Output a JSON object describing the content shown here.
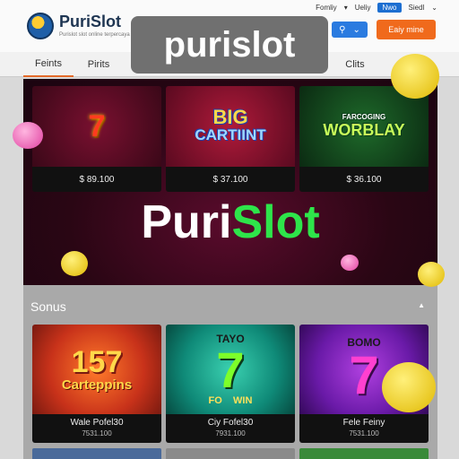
{
  "header": {
    "brand": "PuriSlot",
    "tagline": "Purislot slot online terpercaya",
    "top_links": [
      "Fomliy",
      "Ueliy"
    ],
    "top_badge": "Nwo",
    "top_right": "Siedl",
    "search_icon": "search-icon",
    "cta_label": "Eaiy mine"
  },
  "watermark": "purislot",
  "nav": {
    "tabs": [
      "Feints",
      "Pirits",
      "Clits"
    ]
  },
  "hero": {
    "cards": [
      {
        "art": "7",
        "price": "$ 89.100"
      },
      {
        "art_line1": "BIG",
        "art_line2": "CARTIINT",
        "price": "$ 37.100"
      },
      {
        "art_small": "FARCOGING",
        "art": "WORBLAY",
        "price": "$ 36.100"
      }
    ],
    "title_part1": "Puri",
    "title_part2": "Slot"
  },
  "section": {
    "title": "Sonus",
    "promos": [
      {
        "top": "157",
        "label": "Carteppins",
        "title": "Wale Pofel30",
        "sub": "7531.100"
      },
      {
        "top": "TAYO",
        "big": "7",
        "label": "FO    WIN",
        "title": "Ciy Fofel30",
        "sub": "7931.100"
      },
      {
        "top": "BOMO",
        "big": "7",
        "title": "Fele Feiny",
        "sub": "7531.100"
      }
    ]
  },
  "colors": {
    "accent": "#e36a2a",
    "cta": "#f06a1c",
    "brand_green": "#2ee54a",
    "hero_bg": "#2a0614"
  }
}
